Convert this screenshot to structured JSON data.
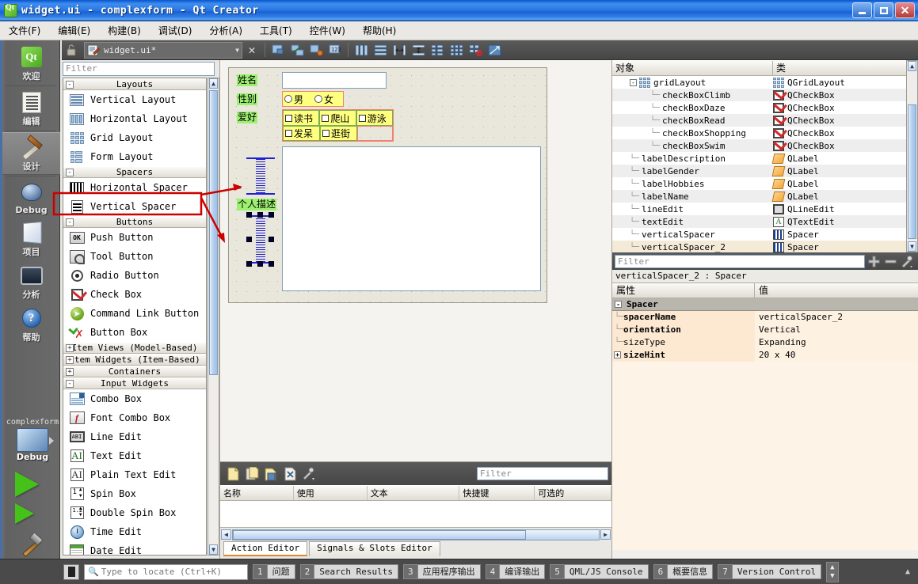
{
  "window": {
    "title": "widget.ui - complexform - Qt Creator",
    "app_icon": "qt-logo-icon",
    "minimize": "minimize-icon",
    "maximize": "maximize-icon",
    "close": "close-icon"
  },
  "menubar": {
    "items": [
      {
        "label": "文件(F)"
      },
      {
        "label": "编辑(E)"
      },
      {
        "label": "构建(B)"
      },
      {
        "label": "调试(D)"
      },
      {
        "label": "分析(A)"
      },
      {
        "label": "工具(T)"
      },
      {
        "label": "控件(W)"
      },
      {
        "label": "帮助(H)"
      }
    ]
  },
  "modebar": {
    "items": [
      {
        "label": "欢迎",
        "icon": "qt-welcome-icon",
        "selected": false
      },
      {
        "label": "编辑",
        "icon": "edit-document-icon",
        "selected": false
      },
      {
        "label": "设计",
        "icon": "design-brush-ruler-icon",
        "selected": true
      },
      {
        "label": "Debug",
        "icon": "debug-bug-icon",
        "selected": false
      },
      {
        "label": "项目",
        "icon": "projects-book-icon",
        "selected": false
      },
      {
        "label": "分析",
        "icon": "analyze-monitor-icon",
        "selected": false
      },
      {
        "label": "帮助",
        "icon": "help-question-icon",
        "selected": false
      }
    ],
    "kit": {
      "project": "complexform",
      "build_config": "Debug",
      "selector_icon": "computer-kit-icon",
      "run_icon": "run-play-icon",
      "debug_run_icon": "debug-run-icon",
      "build_icon": "build-hammer-icon"
    }
  },
  "editor_toolbar": {
    "lock_icon": "lock-open-icon",
    "file_icon": "ui-file-icon",
    "filename": "widget.ui*",
    "dropdown_icon": "chevron-down-icon",
    "close_icon": "close-editor-icon",
    "tools": [
      "edit-widgets-icon",
      "edit-signals-slots-icon",
      "edit-buddies-icon",
      "edit-tab-order-icon",
      "layout-horizontal-icon",
      "layout-vertical-icon",
      "layout-splitter-horizontal-icon",
      "layout-splitter-vertical-icon",
      "layout-form-icon",
      "layout-grid-icon",
      "layout-break-icon",
      "layout-adjust-size-icon"
    ]
  },
  "widget_box": {
    "filter_placeholder": "Filter",
    "groups": [
      {
        "name": "Layouts",
        "expanded": true,
        "toggle": "-",
        "items": [
          {
            "label": "Vertical Layout",
            "icon": "vertical-layout-icon"
          },
          {
            "label": "Horizontal Layout",
            "icon": "horizontal-layout-icon"
          },
          {
            "label": "Grid Layout",
            "icon": "grid-layout-icon"
          },
          {
            "label": "Form Layout",
            "icon": "form-layout-icon"
          }
        ]
      },
      {
        "name": "Spacers",
        "expanded": true,
        "toggle": "-",
        "items": [
          {
            "label": "Horizontal Spacer",
            "icon": "horizontal-spacer-icon"
          },
          {
            "label": "Vertical Spacer",
            "icon": "vertical-spacer-icon",
            "highlighted": true
          }
        ]
      },
      {
        "name": "Buttons",
        "expanded": true,
        "toggle": "-",
        "items": [
          {
            "label": "Push Button",
            "icon": "push-button-icon"
          },
          {
            "label": "Tool Button",
            "icon": "tool-button-icon"
          },
          {
            "label": "Radio Button",
            "icon": "radio-button-icon"
          },
          {
            "label": "Check Box",
            "icon": "check-box-icon"
          },
          {
            "label": "Command Link Button",
            "icon": "command-link-button-icon"
          },
          {
            "label": "Button Box",
            "icon": "button-box-icon"
          }
        ]
      },
      {
        "name": "Item Views (Model-Based)",
        "expanded": false,
        "toggle": "+",
        "items": []
      },
      {
        "name": "Item Widgets (Item-Based)",
        "expanded": false,
        "toggle": "+",
        "items": []
      },
      {
        "name": "Containers",
        "expanded": false,
        "toggle": "+",
        "items": []
      },
      {
        "name": "Input Widgets",
        "expanded": true,
        "toggle": "-",
        "items": [
          {
            "label": "Combo Box",
            "icon": "combo-box-icon"
          },
          {
            "label": "Font Combo Box",
            "icon": "font-combo-box-icon"
          },
          {
            "label": "Line Edit",
            "icon": "line-edit-icon"
          },
          {
            "label": "Text Edit",
            "icon": "text-edit-icon"
          },
          {
            "label": "Plain Text Edit",
            "icon": "plain-text-edit-icon"
          },
          {
            "label": "Spin Box",
            "icon": "spin-box-icon"
          },
          {
            "label": "Double Spin Box",
            "icon": "double-spin-box-icon"
          },
          {
            "label": "Time Edit",
            "icon": "time-edit-icon"
          },
          {
            "label": "Date Edit",
            "icon": "date-edit-icon"
          }
        ]
      }
    ]
  },
  "form": {
    "labels": {
      "name": "姓名",
      "gender": "性别",
      "hobbies": "爱好",
      "description": "个人描述"
    },
    "line_edit_value": "",
    "radios": [
      {
        "label": "男",
        "checked": false
      },
      {
        "label": "女",
        "checked": false
      }
    ],
    "checkboxes": [
      {
        "label": "读书",
        "checked": false
      },
      {
        "label": "爬山",
        "checked": false
      },
      {
        "label": "游泳",
        "checked": false
      },
      {
        "label": "发呆",
        "checked": false
      },
      {
        "label": "逛街",
        "checked": false
      }
    ],
    "text_edit_value": "",
    "spacers": [
      {
        "name": "verticalSpacer",
        "selected": false
      },
      {
        "name": "verticalSpacer_2",
        "selected": true
      }
    ]
  },
  "annotations": {
    "highlight_target": "Vertical Spacer",
    "arrow_count": 2,
    "color": "#cc0000"
  },
  "action_editor": {
    "toolbar_icons": [
      "new-action-icon",
      "copy-action-icon",
      "paste-action-icon",
      "delete-action-icon",
      "edit-action-icon"
    ],
    "filter_placeholder": "Filter",
    "columns": [
      "名称",
      "使用",
      "文本",
      "快捷键",
      "可选的"
    ],
    "rows": [],
    "tabs": [
      {
        "label": "Action Editor",
        "selected": true
      },
      {
        "label": "Signals & Slots Editor",
        "selected": false
      }
    ]
  },
  "object_inspector": {
    "columns": [
      "对象",
      "类"
    ],
    "rows": [
      {
        "name": "gridLayout",
        "class": "QGridLayout",
        "depth": 1,
        "icon": "grid-layout-icon",
        "expander": "-"
      },
      {
        "name": "checkBoxClimb",
        "class": "QCheckBox",
        "depth": 2,
        "icon": "check-box-icon"
      },
      {
        "name": "checkBoxDaze",
        "class": "QCheckBox",
        "depth": 2,
        "icon": "check-box-icon"
      },
      {
        "name": "checkBoxRead",
        "class": "QCheckBox",
        "depth": 2,
        "icon": "check-box-icon"
      },
      {
        "name": "checkBoxShopping",
        "class": "QCheckBox",
        "depth": 2,
        "icon": "check-box-icon"
      },
      {
        "name": "checkBoxSwim",
        "class": "QCheckBox",
        "depth": 2,
        "icon": "check-box-icon"
      },
      {
        "name": "labelDescription",
        "class": "QLabel",
        "depth": 1,
        "icon": "label-icon"
      },
      {
        "name": "labelGender",
        "class": "QLabel",
        "depth": 1,
        "icon": "label-icon"
      },
      {
        "name": "labelHobbies",
        "class": "QLabel",
        "depth": 1,
        "icon": "label-icon"
      },
      {
        "name": "labelName",
        "class": "QLabel",
        "depth": 1,
        "icon": "label-icon"
      },
      {
        "name": "lineEdit",
        "class": "QLineEdit",
        "depth": 1,
        "icon": "line-edit-icon"
      },
      {
        "name": "textEdit",
        "class": "QTextEdit",
        "depth": 1,
        "icon": "text-edit-icon"
      },
      {
        "name": "verticalSpacer",
        "class": "Spacer",
        "depth": 1,
        "icon": "spacer-icon"
      },
      {
        "name": "verticalSpacer_2",
        "class": "Spacer",
        "depth": 1,
        "icon": "spacer-icon",
        "selected": true
      }
    ]
  },
  "property_editor": {
    "filter_placeholder": "Filter",
    "add_icon": "plus-icon",
    "remove_icon": "minus-icon",
    "config_icon": "wrench-icon",
    "object_line": "verticalSpacer_2 : Spacer",
    "columns": [
      "属性",
      "值"
    ],
    "group": {
      "name": "Spacer",
      "toggle": "-"
    },
    "properties": [
      {
        "key": "spacerName",
        "value": "verticalSpacer_2",
        "bold": true,
        "expander": ""
      },
      {
        "key": "orientation",
        "value": "Vertical",
        "bold": true,
        "expander": ""
      },
      {
        "key": "sizeType",
        "value": "Expanding",
        "bold": false,
        "expander": ""
      },
      {
        "key": "sizeHint",
        "value": "20 x 40",
        "bold": true,
        "expander": "+"
      }
    ]
  },
  "statusbar": {
    "locator_icon": "search-icon",
    "locator_placeholder": "Type to locate (Ctrl+K)",
    "panes": [
      {
        "num": "1",
        "label": "问题"
      },
      {
        "num": "2",
        "label": "Search Results"
      },
      {
        "num": "3",
        "label": "应用程序输出"
      },
      {
        "num": "4",
        "label": "编译输出"
      },
      {
        "num": "5",
        "label": "QML/JS Console"
      },
      {
        "num": "6",
        "label": "概要信息"
      },
      {
        "num": "7",
        "label": "Version Control"
      }
    ],
    "updown_icon": "up-down-arrows-icon",
    "collapse_icon": "collapse-up-icon"
  }
}
